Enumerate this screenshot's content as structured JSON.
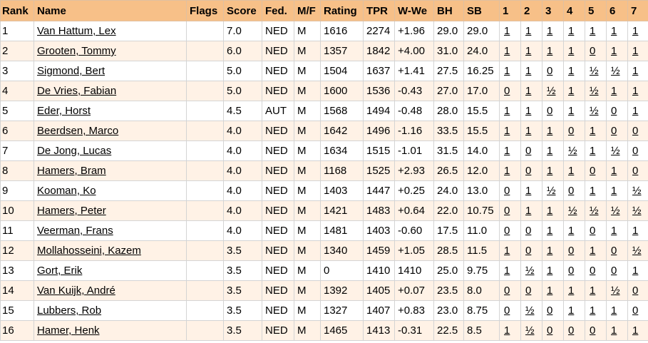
{
  "headers": [
    "Rank",
    "Name",
    "Flags",
    "Score",
    "Fed.",
    "M/F",
    "Rating",
    "TPR",
    "W-We",
    "BH",
    "SB",
    "1",
    "2",
    "3",
    "4",
    "5",
    "6",
    "7"
  ],
  "rows": [
    {
      "rank": "1",
      "name": "Van Hattum, Lex",
      "flags": "",
      "score": "7.0",
      "fed": "NED",
      "mf": "M",
      "rating": "1616",
      "tpr": "2274",
      "wwe": "+1.96",
      "bh": "29.0",
      "sb": "29.0",
      "rounds": [
        "1",
        "1",
        "1",
        "1",
        "1",
        "1",
        "1"
      ]
    },
    {
      "rank": "2",
      "name": "Grooten, Tommy",
      "flags": "",
      "score": "6.0",
      "fed": "NED",
      "mf": "M",
      "rating": "1357",
      "tpr": "1842",
      "wwe": "+4.00",
      "bh": "31.0",
      "sb": "24.0",
      "rounds": [
        "1",
        "1",
        "1",
        "1",
        "0",
        "1",
        "1"
      ]
    },
    {
      "rank": "3",
      "name": "Sigmond, Bert",
      "flags": "",
      "score": "5.0",
      "fed": "NED",
      "mf": "M",
      "rating": "1504",
      "tpr": "1637",
      "wwe": "+1.41",
      "bh": "27.5",
      "sb": "16.25",
      "rounds": [
        "1",
        "1",
        "0",
        "1",
        "½",
        "½",
        "1"
      ]
    },
    {
      "rank": "4",
      "name": "De Vries, Fabian",
      "flags": "",
      "score": "5.0",
      "fed": "NED",
      "mf": "M",
      "rating": "1600",
      "tpr": "1536",
      "wwe": "-0.43",
      "bh": "27.0",
      "sb": "17.0",
      "rounds": [
        "0",
        "1",
        "½",
        "1",
        "½",
        "1",
        "1"
      ]
    },
    {
      "rank": "5",
      "name": "Eder, Horst",
      "flags": "",
      "score": "4.5",
      "fed": "AUT",
      "mf": "M",
      "rating": "1568",
      "tpr": "1494",
      "wwe": "-0.48",
      "bh": "28.0",
      "sb": "15.5",
      "rounds": [
        "1",
        "1",
        "0",
        "1",
        "½",
        "0",
        "1"
      ]
    },
    {
      "rank": "6",
      "name": "Beerdsen, Marco",
      "flags": "",
      "score": "4.0",
      "fed": "NED",
      "mf": "M",
      "rating": "1642",
      "tpr": "1496",
      "wwe": "-1.16",
      "bh": "33.5",
      "sb": "15.5",
      "rounds": [
        "1",
        "1",
        "1",
        "0",
        "1",
        "0",
        "0"
      ]
    },
    {
      "rank": "7",
      "name": "De Jong, Lucas",
      "flags": "",
      "score": "4.0",
      "fed": "NED",
      "mf": "M",
      "rating": "1634",
      "tpr": "1515",
      "wwe": "-1.01",
      "bh": "31.5",
      "sb": "14.0",
      "rounds": [
        "1",
        "0",
        "1",
        "½",
        "1",
        "½",
        "0"
      ]
    },
    {
      "rank": "8",
      "name": "Hamers, Bram",
      "flags": "",
      "score": "4.0",
      "fed": "NED",
      "mf": "M",
      "rating": "1168",
      "tpr": "1525",
      "wwe": "+2.93",
      "bh": "26.5",
      "sb": "12.0",
      "rounds": [
        "1",
        "0",
        "1",
        "1",
        "0",
        "1",
        "0"
      ]
    },
    {
      "rank": "9",
      "name": "Kooman, Ko",
      "flags": "",
      "score": "4.0",
      "fed": "NED",
      "mf": "M",
      "rating": "1403",
      "tpr": "1447",
      "wwe": "+0.25",
      "bh": "24.0",
      "sb": "13.0",
      "rounds": [
        "0",
        "1",
        "½",
        "0",
        "1",
        "1",
        "½"
      ]
    },
    {
      "rank": "10",
      "name": "Hamers, Peter",
      "flags": "",
      "score": "4.0",
      "fed": "NED",
      "mf": "M",
      "rating": "1421",
      "tpr": "1483",
      "wwe": "+0.64",
      "bh": "22.0",
      "sb": "10.75",
      "rounds": [
        "0",
        "1",
        "1",
        "½",
        "½",
        "½",
        "½"
      ]
    },
    {
      "rank": "11",
      "name": "Veerman, Frans",
      "flags": "",
      "score": "4.0",
      "fed": "NED",
      "mf": "M",
      "rating": "1481",
      "tpr": "1403",
      "wwe": "-0.60",
      "bh": "17.5",
      "sb": "11.0",
      "rounds": [
        "0",
        "0",
        "1",
        "1",
        "0",
        "1",
        "1"
      ]
    },
    {
      "rank": "12",
      "name": "Mollahosseini, Kazem",
      "flags": "",
      "score": "3.5",
      "fed": "NED",
      "mf": "M",
      "rating": "1340",
      "tpr": "1459",
      "wwe": "+1.05",
      "bh": "28.5",
      "sb": "11.5",
      "rounds": [
        "1",
        "0",
        "1",
        "0",
        "1",
        "0",
        "½"
      ]
    },
    {
      "rank": "13",
      "name": "Gort, Erik",
      "flags": "",
      "score": "3.5",
      "fed": "NED",
      "mf": "M",
      "rating": "0",
      "tpr": "1410",
      "wwe": "1410",
      "bh": "25.0",
      "sb": "9.75",
      "rounds": [
        "1",
        "½",
        "1",
        "0",
        "0",
        "0",
        "1"
      ]
    },
    {
      "rank": "14",
      "name": "Van Kuijk, André",
      "flags": "",
      "score": "3.5",
      "fed": "NED",
      "mf": "M",
      "rating": "1392",
      "tpr": "1405",
      "wwe": "+0.07",
      "bh": "23.5",
      "sb": "8.0",
      "rounds": [
        "0",
        "0",
        "1",
        "1",
        "1",
        "½",
        "0"
      ]
    },
    {
      "rank": "15",
      "name": "Lubbers, Rob",
      "flags": "",
      "score": "3.5",
      "fed": "NED",
      "mf": "M",
      "rating": "1327",
      "tpr": "1407",
      "wwe": "+0.83",
      "bh": "23.0",
      "sb": "8.75",
      "rounds": [
        "0",
        "½",
        "0",
        "1",
        "1",
        "1",
        "0"
      ]
    },
    {
      "rank": "16",
      "name": "Hamer, Henk",
      "flags": "",
      "score": "3.5",
      "fed": "NED",
      "mf": "M",
      "rating": "1465",
      "tpr": "1413",
      "wwe": "-0.31",
      "bh": "22.5",
      "sb": "8.5",
      "rounds": [
        "1",
        "½",
        "0",
        "0",
        "0",
        "1",
        "1"
      ]
    }
  ]
}
